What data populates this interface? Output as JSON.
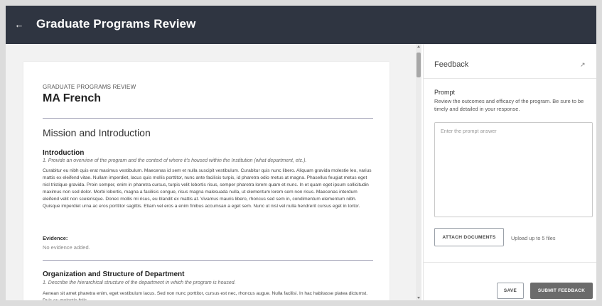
{
  "header": {
    "back_icon": "arrow-left-icon",
    "title": "Graduate Programs Review"
  },
  "document": {
    "eyebrow": "GRADUATE PROGRAMS REVIEW",
    "title": "MA French",
    "section_heading": "Mission and Introduction",
    "sections": [
      {
        "heading": "Introduction",
        "prompt": "1. Provide an overview of the program and the context of where it's housed within the Institution (what department, etc.).",
        "body": "Curabitur eu nibh quis erat maximus vestibulum. Maecenas id sem et nulla suscipit vestibulum. Curabitur quis nunc libero. Aliquam gravida molestie leo, varius mattis ex eleifend vitae. Nullam imperdiet, lacus quis mollis porttitor, nunc ante facilisis turpis, id pharetra odio metus at magna. Phasellus feugiat metus eget nisl tristique gravida. Proin semper, enim in pharetra cursus, turpis velit lobortis risus, semper pharetra lorem quam et nunc. In et quam eget ipsum sollicitudin maximus non sed dolor. Morbi lobortis, magna a facilisis congue, risus magna malesuada nulla, ut elementum lorem sem non risus. Maecenas interdum eleifend velit non scelerisque. Donec mollis mi risus, eu blandit ex mattis at. Vivamus mauris libero, rhoncus sed sem in, condimentum elementum nibh. Quisque imperdiet urna ac eros porttitor sagittis. Etiam vel eros a enim finibus accumsan a eget sem. Nunc ut nisl vel nulla hendrerit cursus eget in tortor.",
        "evidence_label": "Evidence:",
        "evidence_value": "No evidence added."
      },
      {
        "heading": "Organization and Structure of Department",
        "prompt": "1. Describe the hierarchical structure of the department in which the program is housed.",
        "body": "Aenean sit amet pharetra enim, eget vestibulum lacus. Sed non nunc porttitor, cursus est nec, rhoncus augue. Nulla facilisi. In hac habitasse platea dictumst. Duis eu molestie felis."
      }
    ]
  },
  "feedback": {
    "title": "Feedback",
    "expand_icon": "expand-icon",
    "prompt_label": "Prompt",
    "prompt_text": "Review the outcomes and efficacy of the program. Be sure to be timely and detailed in your response.",
    "answer_value": "",
    "answer_placeholder": "Enter the prompt answer",
    "attach_label": "ATTACH DOCUMENTS",
    "upload_note": "Upload up to 5 files",
    "save_label": "SAVE",
    "submit_label": "SUBMIT FEEDBACK"
  },
  "colors": {
    "header_bg": "#2f3541",
    "submit_bg": "#6b6b6b",
    "doc_bg": "#f2f2f2"
  }
}
